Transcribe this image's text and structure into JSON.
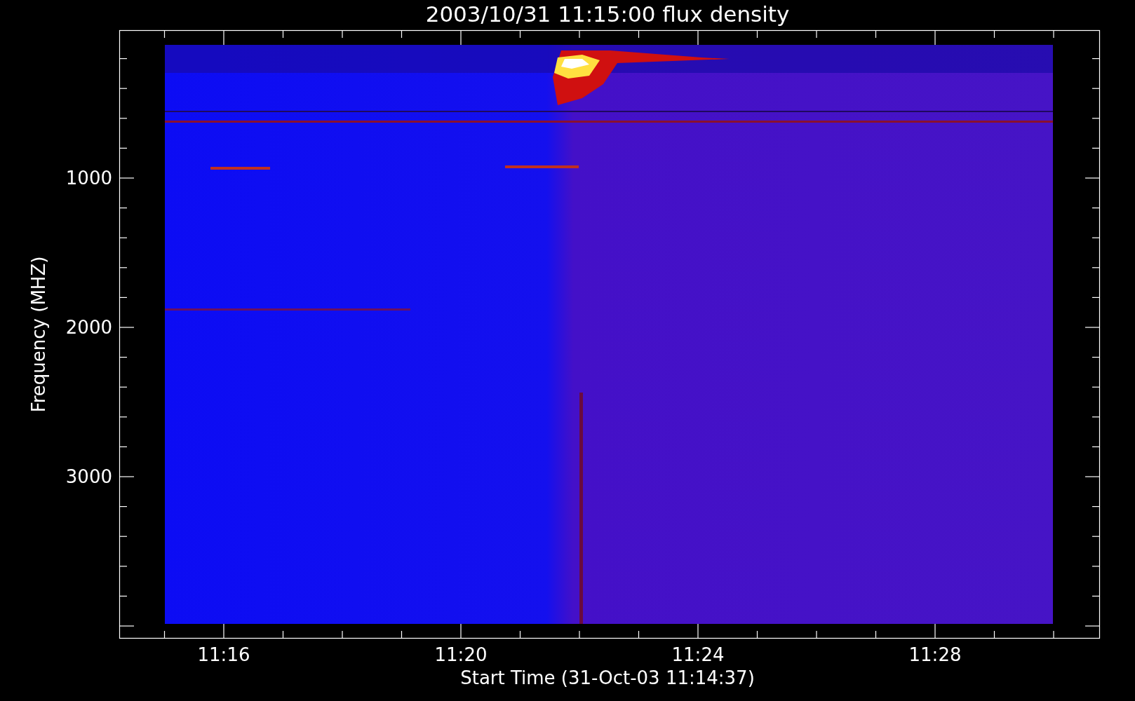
{
  "title": "2003/10/31 11:15:00 flux density",
  "y_axis": {
    "label": "Frequency (MHZ)",
    "tick_labels": [
      "1000",
      "2000",
      "3000"
    ]
  },
  "x_axis": {
    "label": "Start Time (31-Oct-03 11:14:37)",
    "tick_labels": [
      "11:16",
      "11:20",
      "11:24",
      "11:28"
    ]
  }
}
